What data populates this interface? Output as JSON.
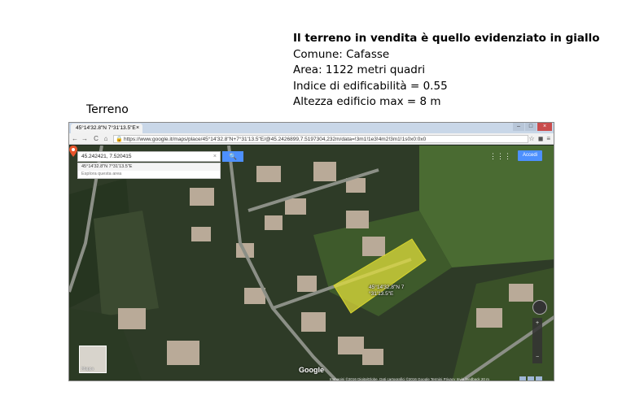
{
  "slide": {
    "title": "Il terreno in vendita è quello evidenziato in giallo",
    "lines": [
      "Comune: Cafasse",
      "Area: 1122 metri quadri",
      "Indice di edificabilità = 0.55",
      "Altezza edificio  max = 8 m"
    ],
    "caption": "Terreno"
  },
  "browser": {
    "tab_title": "45°14'32.8\"N 7°31'13.5\"E",
    "tab_close": "×",
    "url": "https://www.google.it/maps/place/45°14'32.8\"N+7°31'13.5\"E/@45.2426899,7.5197304,232m/data=!3m1!1e3!4m2!3m1!1s0x0:0x0",
    "url_display": "https://www.google.it/maps/place/45°14'32.8\"N+7°31'13.5\"E/@45.2426899,7.5197304,232m/data=!3m1!1e3!4m2!3m1!1s0x0:0x0",
    "back": "←",
    "forward": "→",
    "reload": "C",
    "home": "⌂",
    "window_controls": [
      "–",
      "□",
      "×"
    ]
  },
  "map": {
    "search_value": "45.242421, 7.520415",
    "search_clear": "×",
    "search_button": "🔍",
    "suggestions": [
      "45°14'32.8\"N 7°31'13.5\"E",
      "Esplora questa area"
    ],
    "accedi": "Accedi",
    "apps_icon": "⋮⋮⋮",
    "pin_label_line1": "45°14'32.8\"N 7",
    "pin_label_line2": "°31'13.5\"E",
    "mini_label": "Mappa",
    "google_logo": "Google",
    "attribution": "Immagini ©2016 DigitalGlobe, Dati cartografici ©2016 Google   Termini   Privacy   Invia feedback   20 m",
    "zoom_in": "+",
    "zoom_out": "−",
    "parcel_color": "#e5e23a"
  }
}
